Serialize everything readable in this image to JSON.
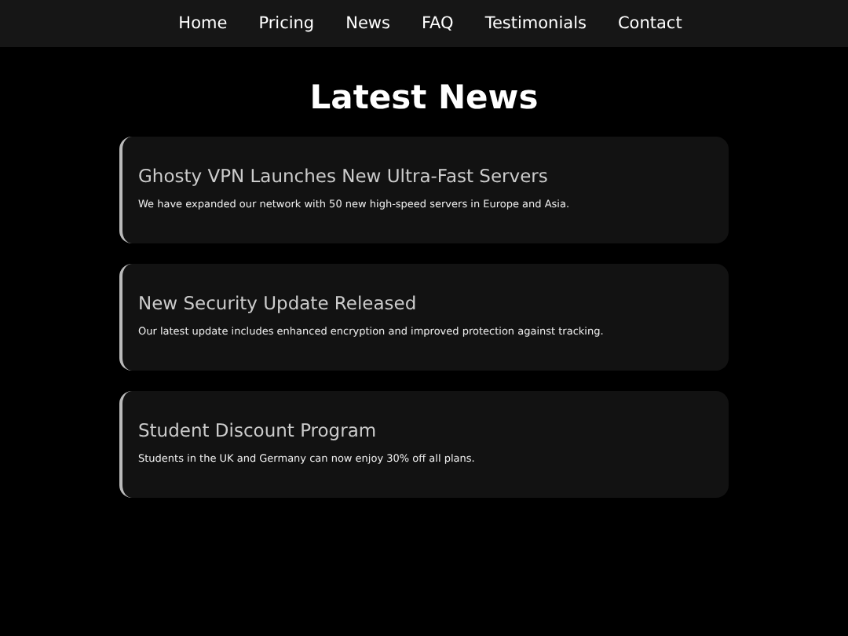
{
  "nav": {
    "links": [
      "Home",
      "Pricing",
      "News",
      "FAQ",
      "Testimonials",
      "Contact"
    ]
  },
  "page": {
    "title": "Latest News"
  },
  "news": [
    {
      "title": "Ghosty VPN Launches New Ultra-Fast Servers",
      "body": "We have expanded our network with 50 new high-speed servers in Europe and Asia."
    },
    {
      "title": "New Security Update Released",
      "body": "Our latest update includes enhanced encryption and improved protection against tracking."
    },
    {
      "title": "Student Discount Program",
      "body": "Students in the UK and Germany can now enjoy 30% off all plans."
    }
  ]
}
